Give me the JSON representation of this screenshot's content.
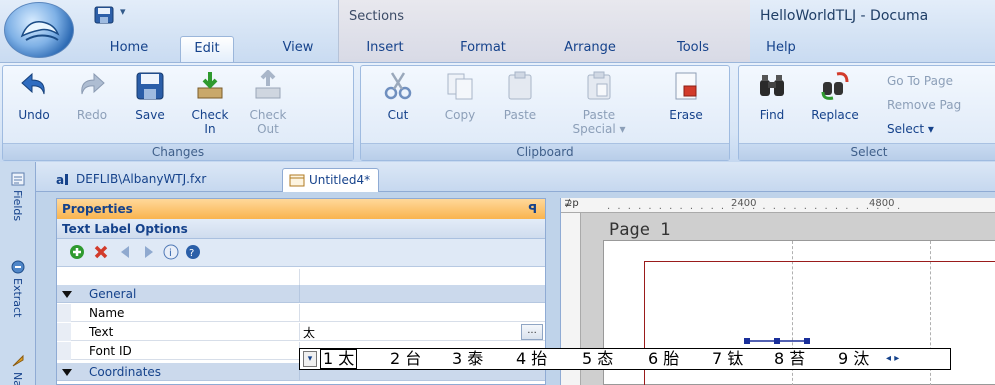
{
  "window": {
    "title": "HelloWorldTLJ - Documa",
    "contextual_group": "Sections"
  },
  "menu_tabs": [
    {
      "label": "Home",
      "active": false
    },
    {
      "label": "Edit",
      "active": true
    },
    {
      "label": "View",
      "active": false
    },
    {
      "label": "Insert",
      "active": false
    },
    {
      "label": "Format",
      "active": false
    },
    {
      "label": "Arrange",
      "active": false
    },
    {
      "label": "Tools",
      "active": false
    },
    {
      "label": "Help",
      "active": false
    }
  ],
  "ribbon": {
    "changes": {
      "label": "Changes",
      "undo": "Undo",
      "redo": "Redo",
      "save": "Save",
      "check_in": "Check\nIn",
      "check_out": "Check\nOut"
    },
    "clipboard": {
      "label": "Clipboard",
      "cut": "Cut",
      "copy": "Copy",
      "paste": "Paste",
      "paste_special": "Paste\nSpecial ▾",
      "erase": "Erase"
    },
    "select": {
      "label": "Select",
      "find": "Find",
      "replace": "Replace",
      "go_to_page": "Go To Page",
      "remove_page": "Remove Pag",
      "select_menu": "Select ▾"
    }
  },
  "document_tabs": [
    {
      "label": "DEFLIB\\AlbanyWTJ.fxr",
      "active": false
    },
    {
      "label": "Untitled4*",
      "active": true
    }
  ],
  "side_panels": [
    "Fields",
    "Extract",
    "Na"
  ],
  "properties": {
    "title": "Properties",
    "pin": "ᵖ",
    "subtitle": "Text Label Options",
    "categories": {
      "general": "General",
      "coordinates": "Coordinates"
    },
    "rows": {
      "name": {
        "label": "Name",
        "value": ""
      },
      "text": {
        "label": "Text",
        "value": "太"
      },
      "font_id": {
        "label": "Font ID",
        "value": ""
      }
    },
    "ellipsis": "..."
  },
  "designer": {
    "ruler_corner": "⊉p",
    "ruler_marks": [
      "2400",
      "4800"
    ],
    "page_title": "Page 1"
  },
  "ime": {
    "arrow": "▾",
    "candidates": [
      "1 太",
      "2 台",
      "3 泰",
      "4 抬",
      "5 态",
      "6 胎",
      "7 钛",
      "8 苔",
      "9 汰"
    ],
    "nav": "◂ ▸"
  }
}
